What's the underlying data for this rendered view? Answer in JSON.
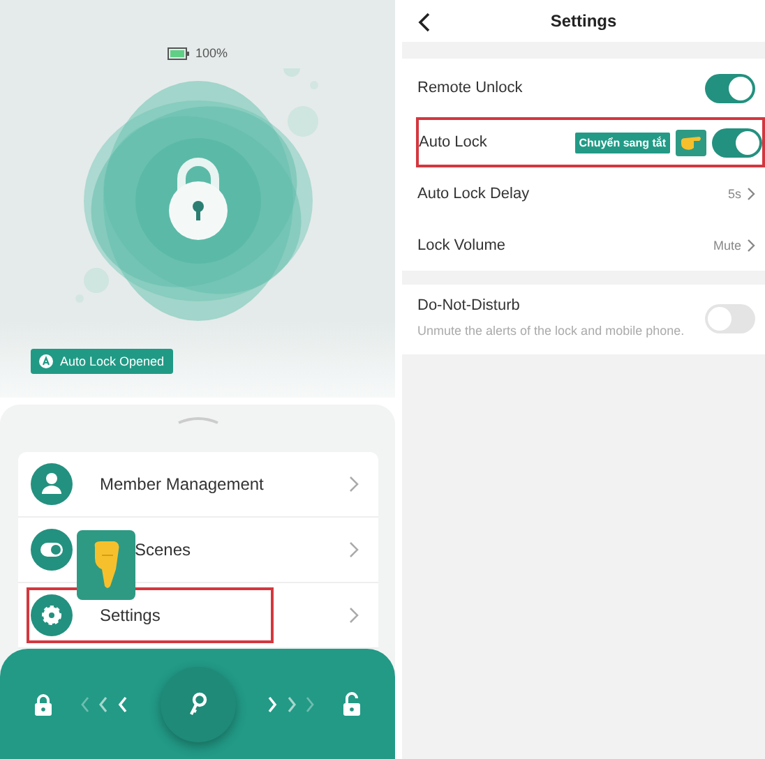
{
  "lock_screen": {
    "battery": "100%",
    "status_badge": "Auto Lock Opened",
    "menu": [
      {
        "label": "Member Management",
        "highlighted": false,
        "hand": false
      },
      {
        "label": "Scenes",
        "highlighted": false,
        "hand": true
      },
      {
        "label": "Settings",
        "highlighted": true,
        "hand": false
      }
    ]
  },
  "settings": {
    "title": "Settings",
    "rows": [
      {
        "kind": "toggle",
        "label": "Remote Unlock",
        "on": true,
        "highlighted": false
      },
      {
        "kind": "toggle",
        "label": "Auto Lock",
        "on": true,
        "highlighted": true,
        "hint": "Chuyển sang tắt"
      },
      {
        "kind": "value",
        "label": "Auto Lock Delay",
        "value": "5s",
        "highlighted": false
      },
      {
        "kind": "value",
        "label": "Lock Volume",
        "value": "Mute",
        "highlighted": false
      }
    ],
    "dnd": {
      "label": "Do-Not-Disturb",
      "description": "Unmute the alerts of the lock and mobile phone.",
      "on": false
    }
  }
}
